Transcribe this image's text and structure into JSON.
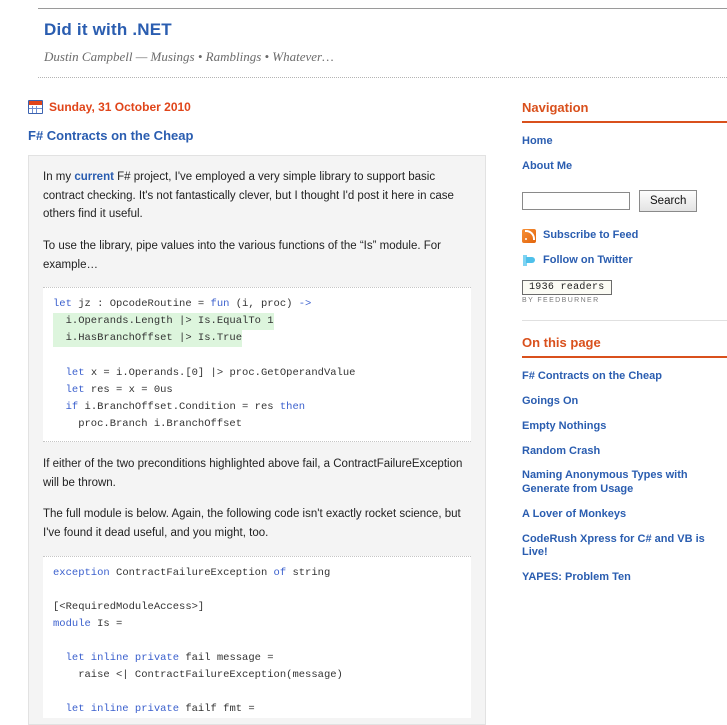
{
  "header": {
    "blog_title": "Did it with .NET",
    "tagline": "Dustin Campbell — Musings • Ramblings • Whatever…"
  },
  "post": {
    "date_icon": "calendar-icon",
    "date": "Sunday, 31 October 2010",
    "title": "F# Contracts on the Cheap",
    "para1_before": "In my ",
    "para1_link": "current",
    "para1_after": " F# project, I've employed a very simple library to support basic contract checking. It's not fantastically clever, but I thought I'd post it here in case others find it useful.",
    "para2": "To use the library, pipe values into the various functions of the “Is” module. For example…",
    "para3": "If either of the two preconditions highlighted above fail, a ContractFailureException will be thrown.",
    "para4": "The full module is below. Again, the following code isn't exactly rocket science, but I've found it dead useful, and you might, too.",
    "code1_line1_k": "let",
    "code1_line1_rest": " jz : OpcodeRoutine = ",
    "code1_line1_k2": "fun",
    "code1_line1_tail": " (i, proc) ",
    "code1_line1_arrow": "->",
    "code1_hl1": "  i.Operands.Length |> Is.EqualTo 1",
    "code1_hl2": "  i.HasBranchOffset |> Is.True",
    "code1_l4_k": "  let",
    "code1_l4": " x = i.Operands.[0] |> proc.GetOperandValue",
    "code1_l5_k": "  let",
    "code1_l5": " res = x = 0us",
    "code1_l6_k": "  if",
    "code1_l6": " i.BranchOffset.Condition = res ",
    "code1_l6_k2": "then",
    "code1_l7": "    proc.Branch i.BranchOffset",
    "code2_l1_k": "exception",
    "code2_l1": " ContractFailureException ",
    "code2_l1_k2": "of",
    "code2_l1_t": " string",
    "code2_l3": "[<RequiredModuleAccess>]",
    "code2_l4_k": "module",
    "code2_l4": " Is =",
    "code2_l6_k": "  let inline private",
    "code2_l6": " fail message =",
    "code2_l7": "    raise <| ContractFailureException(message)",
    "code2_l9_k": "  let inline private",
    "code2_l9": " failf fmt ="
  },
  "sidebar": {
    "navigation_heading": "Navigation",
    "nav_links": [
      "Home",
      "About Me"
    ],
    "search": {
      "value": "",
      "placeholder": "",
      "button_label": "Search"
    },
    "feed": {
      "rss_icon": "rss-icon",
      "rss_label": "Subscribe to Feed",
      "twitter_icon": "twitter-bird-icon",
      "twitter_label": "Follow on Twitter",
      "feedburner_count": "1936 readers",
      "feedburner_by": "BY FEEDBURNER"
    },
    "onpage_heading": "On this page",
    "onpage_links": [
      "F# Contracts on the Cheap",
      "Goings On",
      "Empty Nothings",
      "Random Crash",
      "Naming Anonymous Types with Generate from Usage",
      "A Lover of Monkeys",
      "CodeRush Xpress for C# and VB is Live!",
      "YAPES: Problem Ten"
    ]
  },
  "colors": {
    "heading_orange": "#d9501c",
    "link_blue": "#2a5db0",
    "date_red": "#e0451a",
    "code_keyword": "#3a5fcd",
    "code_highlight": "#ddf5dd"
  }
}
